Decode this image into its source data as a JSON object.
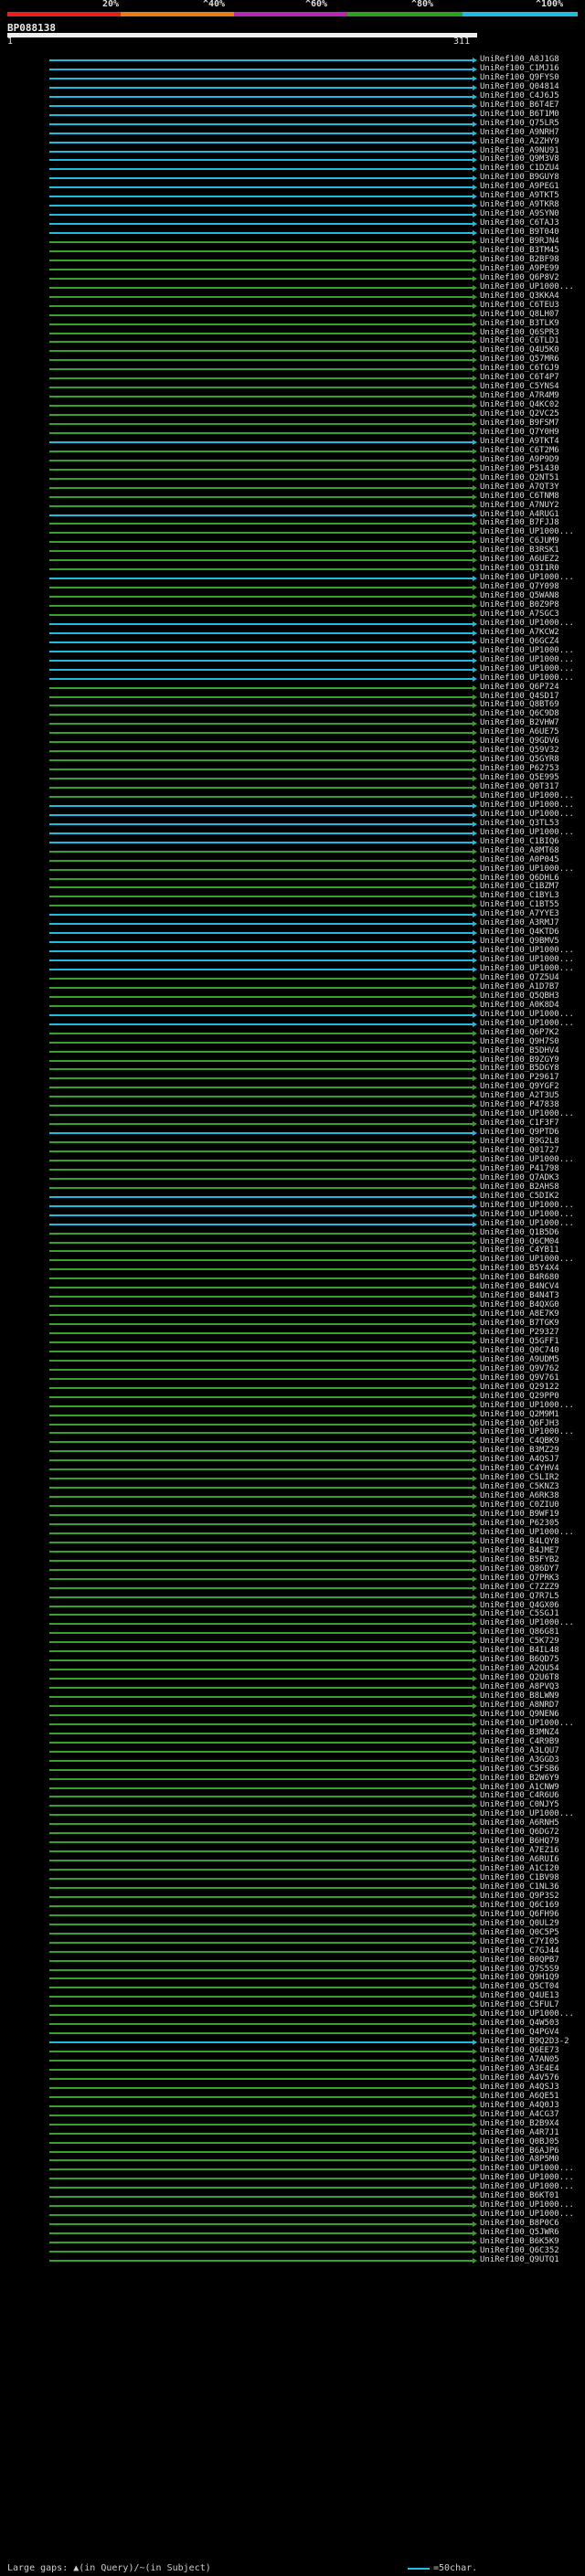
{
  "scale_labels": [
    "20%",
    "^40%",
    "^60%",
    "^80%",
    "^100%"
  ],
  "colors": {
    "red": "#e82020",
    "orange": "#ec7c10",
    "purple": "#b428b4",
    "green": "#2ca020",
    "cyan": "#20bce0",
    "hit_green": "#37a02a",
    "hit_cyan": "#20bce0"
  },
  "query": {
    "id": "BP088138",
    "start": "1",
    "end": "311"
  },
  "hits": [
    {
      "id": "UniRef100_A8J1G8",
      "c": "c"
    },
    {
      "id": "UniRef100_C1MJ16",
      "c": "c"
    },
    {
      "id": "UniRef100_Q9FYS0",
      "c": "c"
    },
    {
      "id": "UniRef100_Q04814",
      "c": "c"
    },
    {
      "id": "UniRef100_C4J6J5",
      "c": "c"
    },
    {
      "id": "UniRef100_B6T4E7",
      "c": "c"
    },
    {
      "id": "UniRef100_B6T1M0",
      "c": "c"
    },
    {
      "id": "UniRef100_Q75LR5",
      "c": "c"
    },
    {
      "id": "UniRef100_A9NRH7",
      "c": "c"
    },
    {
      "id": "UniRef100_A2ZHY9",
      "c": "c"
    },
    {
      "id": "UniRef100_A9NU91",
      "c": "c"
    },
    {
      "id": "UniRef100_Q9M3V8",
      "c": "c"
    },
    {
      "id": "UniRef100_C1DZU4",
      "c": "c"
    },
    {
      "id": "UniRef100_B9GUY8",
      "c": "c"
    },
    {
      "id": "UniRef100_A9PEG1",
      "c": "c"
    },
    {
      "id": "UniRef100_A9TKT5",
      "c": "c"
    },
    {
      "id": "UniRef100_A9TKR8",
      "c": "c"
    },
    {
      "id": "UniRef100_A9SYN0",
      "c": "c"
    },
    {
      "id": "UniRef100_C6TAJ3",
      "c": "c"
    },
    {
      "id": "UniRef100_B9T040",
      "c": "c"
    },
    {
      "id": "UniRef100_B9RJN4",
      "c": "g"
    },
    {
      "id": "UniRef100_B3TM45",
      "c": "g"
    },
    {
      "id": "UniRef100_B2BF98",
      "c": "g"
    },
    {
      "id": "UniRef100_A9PE99",
      "c": "g"
    },
    {
      "id": "UniRef100_Q6P8V2",
      "c": "g"
    },
    {
      "id": "UniRef100_UP1000...",
      "c": "g"
    },
    {
      "id": "UniRef100_Q3KKA4",
      "c": "g"
    },
    {
      "id": "UniRef100_C6TEU3",
      "c": "g"
    },
    {
      "id": "UniRef100_Q8LH07",
      "c": "g"
    },
    {
      "id": "UniRef100_B3TLK9",
      "c": "g"
    },
    {
      "id": "UniRef100_Q6SPR3",
      "c": "g"
    },
    {
      "id": "UniRef100_C6TLD1",
      "c": "g"
    },
    {
      "id": "UniRef100_Q4U5K0",
      "c": "g"
    },
    {
      "id": "UniRef100_Q57MR6",
      "c": "g"
    },
    {
      "id": "UniRef100_C6TGJ9",
      "c": "g"
    },
    {
      "id": "UniRef100_C6T4P7",
      "c": "g"
    },
    {
      "id": "UniRef100_C5YNS4",
      "c": "g"
    },
    {
      "id": "UniRef100_A7R4M9",
      "c": "g"
    },
    {
      "id": "UniRef100_Q4KC02",
      "c": "g"
    },
    {
      "id": "UniRef100_Q2VC25",
      "c": "g"
    },
    {
      "id": "UniRef100_B9FSM7",
      "c": "g"
    },
    {
      "id": "UniRef100_Q7Y0H9",
      "c": "g"
    },
    {
      "id": "UniRef100_A9TKT4",
      "c": "c"
    },
    {
      "id": "UniRef100_C6T2M6",
      "c": "g"
    },
    {
      "id": "UniRef100_A9P9D9",
      "c": "g"
    },
    {
      "id": "UniRef100_P51430",
      "c": "g"
    },
    {
      "id": "UniRef100_Q2NT51",
      "c": "g"
    },
    {
      "id": "UniRef100_A7QT3Y",
      "c": "g"
    },
    {
      "id": "UniRef100_C6TNM8",
      "c": "g"
    },
    {
      "id": "UniRef100_A7NUY2",
      "c": "g"
    },
    {
      "id": "UniRef100_A4RUG1",
      "c": "c"
    },
    {
      "id": "UniRef100_B7FJJ8",
      "c": "g"
    },
    {
      "id": "UniRef100_UP1000...",
      "c": "g"
    },
    {
      "id": "UniRef100_C6JUM9",
      "c": "g"
    },
    {
      "id": "UniRef100_B3RSK1",
      "c": "g"
    },
    {
      "id": "UniRef100_A6UEZ2",
      "c": "g"
    },
    {
      "id": "UniRef100_Q3I1R0",
      "c": "g"
    },
    {
      "id": "UniRef100_UP1000...",
      "c": "c"
    },
    {
      "id": "UniRef100_Q7Y098",
      "c": "g"
    },
    {
      "id": "UniRef100_Q5WAN8",
      "c": "g"
    },
    {
      "id": "UniRef100_B0Z9P8",
      "c": "g"
    },
    {
      "id": "UniRef100_A7SGC3",
      "c": "g"
    },
    {
      "id": "UniRef100_UP1000...",
      "c": "c"
    },
    {
      "id": "UniRef100_A7KCW2",
      "c": "c"
    },
    {
      "id": "UniRef100_Q6GCZ4",
      "c": "c"
    },
    {
      "id": "UniRef100_UP1000...",
      "c": "c"
    },
    {
      "id": "UniRef100_UP1000...",
      "c": "c"
    },
    {
      "id": "UniRef100_UP1000...",
      "c": "c"
    },
    {
      "id": "UniRef100_UP1000...",
      "c": "c"
    },
    {
      "id": "UniRef100_Q6P724",
      "c": "g"
    },
    {
      "id": "UniRef100_Q4SD17",
      "c": "g"
    },
    {
      "id": "UniRef100_Q8BT69",
      "c": "g"
    },
    {
      "id": "UniRef100_Q6C9D8",
      "c": "g"
    },
    {
      "id": "UniRef100_B2VHW7",
      "c": "g"
    },
    {
      "id": "UniRef100_A6UE75",
      "c": "g"
    },
    {
      "id": "UniRef100_Q9GDV6",
      "c": "g"
    },
    {
      "id": "UniRef100_Q59V32",
      "c": "g"
    },
    {
      "id": "UniRef100_Q5GYR8",
      "c": "g"
    },
    {
      "id": "UniRef100_P62753",
      "c": "g"
    },
    {
      "id": "UniRef100_Q5E995",
      "c": "g"
    },
    {
      "id": "UniRef100_Q0T317",
      "c": "g"
    },
    {
      "id": "UniRef100_UP1000...",
      "c": "g"
    },
    {
      "id": "UniRef100_UP1000...",
      "c": "c"
    },
    {
      "id": "UniRef100_UP1000...",
      "c": "c"
    },
    {
      "id": "UniRef100_Q3TL53",
      "c": "c"
    },
    {
      "id": "UniRef100_UP1000...",
      "c": "c"
    },
    {
      "id": "UniRef100_C1BIQ6",
      "c": "c"
    },
    {
      "id": "UniRef100_A8MT68",
      "c": "g"
    },
    {
      "id": "UniRef100_A0P045",
      "c": "g"
    },
    {
      "id": "UniRef100_UP1000...",
      "c": "g"
    },
    {
      "id": "UniRef100_Q6DHL6",
      "c": "g"
    },
    {
      "id": "UniRef100_C1BZM7",
      "c": "g"
    },
    {
      "id": "UniRef100_C1BYL3",
      "c": "g"
    },
    {
      "id": "UniRef100_C1BT55",
      "c": "g"
    },
    {
      "id": "UniRef100_A7YYE3",
      "c": "c"
    },
    {
      "id": "UniRef100_A3RMJ7",
      "c": "c"
    },
    {
      "id": "UniRef100_Q4KTD6",
      "c": "c"
    },
    {
      "id": "UniRef100_Q9BMV5",
      "c": "c"
    },
    {
      "id": "UniRef100_UP1000...",
      "c": "c"
    },
    {
      "id": "UniRef100_UP1000...",
      "c": "c"
    },
    {
      "id": "UniRef100_UP1000...",
      "c": "c"
    },
    {
      "id": "UniRef100_Q7Z5U4",
      "c": "g"
    },
    {
      "id": "UniRef100_A1D7B7",
      "c": "g"
    },
    {
      "id": "UniRef100_Q5QBH3",
      "c": "g"
    },
    {
      "id": "UniRef100_A0K8D4",
      "c": "g"
    },
    {
      "id": "UniRef100_UP1000...",
      "c": "c"
    },
    {
      "id": "UniRef100_UP1000...",
      "c": "c"
    },
    {
      "id": "UniRef100_Q6P7K2",
      "c": "g"
    },
    {
      "id": "UniRef100_Q9H7S0",
      "c": "g"
    },
    {
      "id": "UniRef100_B5DHV4",
      "c": "g"
    },
    {
      "id": "UniRef100_B9ZGY9",
      "c": "g"
    },
    {
      "id": "UniRef100_B5DGY8",
      "c": "g"
    },
    {
      "id": "UniRef100_P29617",
      "c": "g"
    },
    {
      "id": "UniRef100_Q9YGF2",
      "c": "g"
    },
    {
      "id": "UniRef100_A2T3U5",
      "c": "g"
    },
    {
      "id": "UniRef100_P47838",
      "c": "g"
    },
    {
      "id": "UniRef100_UP1000...",
      "c": "g"
    },
    {
      "id": "UniRef100_C1F3F7",
      "c": "g"
    },
    {
      "id": "UniRef100_Q9PTD6",
      "c": "c"
    },
    {
      "id": "UniRef100_B9G2L8",
      "c": "g"
    },
    {
      "id": "UniRef100_Q01727",
      "c": "g"
    },
    {
      "id": "UniRef100_UP1000...",
      "c": "g"
    },
    {
      "id": "UniRef100_P41798",
      "c": "g"
    },
    {
      "id": "UniRef100_Q7ADK3",
      "c": "g"
    },
    {
      "id": "UniRef100_B2AHS8",
      "c": "g"
    },
    {
      "id": "UniRef100_C5DIK2",
      "c": "c"
    },
    {
      "id": "UniRef100_UP1000...",
      "c": "c"
    },
    {
      "id": "UniRef100_UP1000...",
      "c": "c"
    },
    {
      "id": "UniRef100_UP1000...",
      "c": "c"
    },
    {
      "id": "UniRef100_Q1B5D6",
      "c": "g"
    },
    {
      "id": "UniRef100_Q6CM04",
      "c": "g"
    },
    {
      "id": "UniRef100_C4YB11",
      "c": "g"
    },
    {
      "id": "UniRef100_UP1000...",
      "c": "g"
    },
    {
      "id": "UniRef100_B5Y4X4",
      "c": "g"
    },
    {
      "id": "UniRef100_B4R680",
      "c": "g"
    },
    {
      "id": "UniRef100_B4NCV4",
      "c": "g"
    },
    {
      "id": "UniRef100_B4N4T3",
      "c": "g"
    },
    {
      "id": "UniRef100_B4QXG0",
      "c": "g"
    },
    {
      "id": "UniRef100_A8E7K9",
      "c": "g"
    },
    {
      "id": "UniRef100_B7TGK9",
      "c": "g"
    },
    {
      "id": "UniRef100_P29327",
      "c": "g"
    },
    {
      "id": "UniRef100_Q5GFF1",
      "c": "g"
    },
    {
      "id": "UniRef100_Q0C740",
      "c": "g"
    },
    {
      "id": "UniRef100_A9UDM5",
      "c": "g"
    },
    {
      "id": "UniRef100_Q9V762",
      "c": "g"
    },
    {
      "id": "UniRef100_Q9V761",
      "c": "g"
    },
    {
      "id": "UniRef100_Q29122",
      "c": "g"
    },
    {
      "id": "UniRef100_Q29PP0",
      "c": "g"
    },
    {
      "id": "UniRef100_UP1000...",
      "c": "g"
    },
    {
      "id": "UniRef100_Q2M9M1",
      "c": "g"
    },
    {
      "id": "UniRef100_Q6FJH3",
      "c": "g"
    },
    {
      "id": "UniRef100_UP1000...",
      "c": "g"
    },
    {
      "id": "UniRef100_C4QBK9",
      "c": "g"
    },
    {
      "id": "UniRef100_B3MZ29",
      "c": "g"
    },
    {
      "id": "UniRef100_A4QSJ7",
      "c": "g"
    },
    {
      "id": "UniRef100_C4YHV4",
      "c": "g"
    },
    {
      "id": "UniRef100_C5LIR2",
      "c": "g"
    },
    {
      "id": "UniRef100_C5KNZ3",
      "c": "g"
    },
    {
      "id": "UniRef100_A6RK38",
      "c": "g"
    },
    {
      "id": "UniRef100_C0ZIU0",
      "c": "g"
    },
    {
      "id": "UniRef100_B9WF19",
      "c": "g"
    },
    {
      "id": "UniRef100_P62305",
      "c": "g"
    },
    {
      "id": "UniRef100_UP1000...",
      "c": "g"
    },
    {
      "id": "UniRef100_B4LQY8",
      "c": "g"
    },
    {
      "id": "UniRef100_B4JME7",
      "c": "g"
    },
    {
      "id": "UniRef100_B5FYB2",
      "c": "g"
    },
    {
      "id": "UniRef100_Q86DY7",
      "c": "g"
    },
    {
      "id": "UniRef100_Q7PRK3",
      "c": "g"
    },
    {
      "id": "UniRef100_C7ZZZ9",
      "c": "g"
    },
    {
      "id": "UniRef100_Q7R7L5",
      "c": "g"
    },
    {
      "id": "UniRef100_Q4GX06",
      "c": "g"
    },
    {
      "id": "UniRef100_C5SGJ1",
      "c": "g"
    },
    {
      "id": "UniRef100_UP1000...",
      "c": "g"
    },
    {
      "id": "UniRef100_Q86G81",
      "c": "g"
    },
    {
      "id": "UniRef100_C5K729",
      "c": "g"
    },
    {
      "id": "UniRef100_B4IL48",
      "c": "g"
    },
    {
      "id": "UniRef100_B6QD75",
      "c": "g"
    },
    {
      "id": "UniRef100_A2QU54",
      "c": "g"
    },
    {
      "id": "UniRef100_Q2U6T8",
      "c": "g"
    },
    {
      "id": "UniRef100_A8PVQ3",
      "c": "g"
    },
    {
      "id": "UniRef100_B8LWN9",
      "c": "g"
    },
    {
      "id": "UniRef100_A8NRD7",
      "c": "g"
    },
    {
      "id": "UniRef100_Q9NEN6",
      "c": "g"
    },
    {
      "id": "UniRef100_UP1000...",
      "c": "g"
    },
    {
      "id": "UniRef100_B3MNZ4",
      "c": "g"
    },
    {
      "id": "UniRef100_C4R9B9",
      "c": "g"
    },
    {
      "id": "UniRef100_A3LQU7",
      "c": "g"
    },
    {
      "id": "UniRef100_A3GGD3",
      "c": "g"
    },
    {
      "id": "UniRef100_C5FSB6",
      "c": "g"
    },
    {
      "id": "UniRef100_B2W6Y9",
      "c": "g"
    },
    {
      "id": "UniRef100_A1CNW9",
      "c": "g"
    },
    {
      "id": "UniRef100_C4R6U6",
      "c": "g"
    },
    {
      "id": "UniRef100_C0NJY5",
      "c": "g"
    },
    {
      "id": "UniRef100_UP1000...",
      "c": "g"
    },
    {
      "id": "UniRef100_A6RNH5",
      "c": "g"
    },
    {
      "id": "UniRef100_Q6DG72",
      "c": "g"
    },
    {
      "id": "UniRef100_B6HQ79",
      "c": "g"
    },
    {
      "id": "UniRef100_A7EZ16",
      "c": "g"
    },
    {
      "id": "UniRef100_A6RUI6",
      "c": "g"
    },
    {
      "id": "UniRef100_A1CI20",
      "c": "g"
    },
    {
      "id": "UniRef100_C1BV98",
      "c": "g"
    },
    {
      "id": "UniRef100_C1NL36",
      "c": "g"
    },
    {
      "id": "UniRef100_Q9P3S2",
      "c": "g"
    },
    {
      "id": "UniRef100_Q6C169",
      "c": "g"
    },
    {
      "id": "UniRef100_Q6FH96",
      "c": "g"
    },
    {
      "id": "UniRef100_Q0UL29",
      "c": "g"
    },
    {
      "id": "UniRef100_Q0C5P5",
      "c": "g"
    },
    {
      "id": "UniRef100_C7YI05",
      "c": "g"
    },
    {
      "id": "UniRef100_C7GJ44",
      "c": "g"
    },
    {
      "id": "UniRef100_B0QPB7",
      "c": "g"
    },
    {
      "id": "UniRef100_Q7S5S9",
      "c": "g"
    },
    {
      "id": "UniRef100_Q9H1Q9",
      "c": "g"
    },
    {
      "id": "UniRef100_Q5CT04",
      "c": "g"
    },
    {
      "id": "UniRef100_Q4UE13",
      "c": "g"
    },
    {
      "id": "UniRef100_C5FUL7",
      "c": "g"
    },
    {
      "id": "UniRef100_UP1000...",
      "c": "g"
    },
    {
      "id": "UniRef100_Q4W503",
      "c": "g"
    },
    {
      "id": "UniRef100_Q4PGV4",
      "c": "g"
    },
    {
      "id": "UniRef100_B9Q2D3-2",
      "c": "c"
    },
    {
      "id": "UniRef100_Q6EE73",
      "c": "g"
    },
    {
      "id": "UniRef100_A7AN05",
      "c": "g"
    },
    {
      "id": "UniRef100_A3E4E4",
      "c": "g"
    },
    {
      "id": "UniRef100_A4V576",
      "c": "g"
    },
    {
      "id": "UniRef100_A4QSJ3",
      "c": "g"
    },
    {
      "id": "UniRef100_A6QE51",
      "c": "g"
    },
    {
      "id": "UniRef100_A4Q0J3",
      "c": "g"
    },
    {
      "id": "UniRef100_A4CG37",
      "c": "g"
    },
    {
      "id": "UniRef100_B2B9X4",
      "c": "g"
    },
    {
      "id": "UniRef100_A4R7J1",
      "c": "g"
    },
    {
      "id": "UniRef100_Q0BJ05",
      "c": "g"
    },
    {
      "id": "UniRef100_B6AJP6",
      "c": "g"
    },
    {
      "id": "UniRef100_A8P5M0",
      "c": "g"
    },
    {
      "id": "UniRef100_UP1000...",
      "c": "g"
    },
    {
      "id": "UniRef100_UP1000...",
      "c": "g"
    },
    {
      "id": "UniRef100_UP1000...",
      "c": "g"
    },
    {
      "id": "UniRef100_B6KT01",
      "c": "g"
    },
    {
      "id": "UniRef100_UP1000...",
      "c": "g"
    },
    {
      "id": "UniRef100_UP1000...",
      "c": "g"
    },
    {
      "id": "UniRef100_B8P0C6",
      "c": "g"
    },
    {
      "id": "UniRef100_Q5JWR6",
      "c": "g"
    },
    {
      "id": "UniRef100_B6K5K9",
      "c": "g"
    },
    {
      "id": "UniRef100_Q6C352",
      "c": "g"
    },
    {
      "id": "UniRef100_Q9UTQ1",
      "c": "g"
    }
  ],
  "footer": {
    "legend": "Large gaps: ▲(in Query)/~(in Subject)",
    "key_label": "=50char."
  }
}
